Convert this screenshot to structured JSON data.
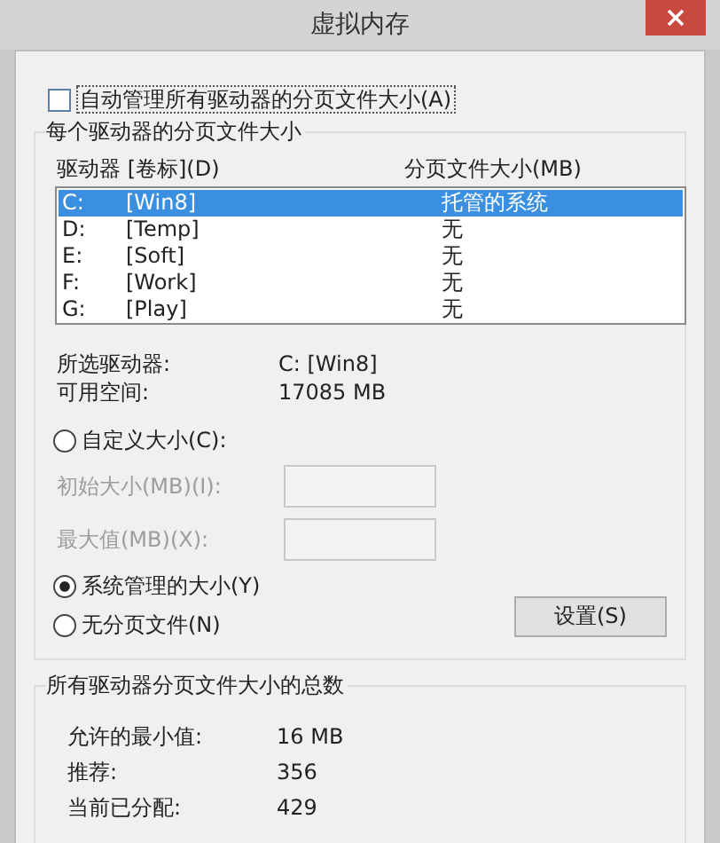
{
  "window": {
    "title": "虚拟内存"
  },
  "auto_manage": {
    "label": "自动管理所有驱动器的分页文件大小(A)",
    "checked": false
  },
  "per_drive": {
    "title": "每个驱动器的分页文件大小",
    "columns": [
      "驱动器 [卷标](D)",
      "分页文件大小(MB)"
    ],
    "drives": [
      {
        "letter": "C:",
        "label": "[Win8]",
        "size": "托管的系统",
        "selected": true
      },
      {
        "letter": "D:",
        "label": "[Temp]",
        "size": "无",
        "selected": false
      },
      {
        "letter": "E:",
        "label": "[Soft]",
        "size": "无",
        "selected": false
      },
      {
        "letter": "F:",
        "label": "[Work]",
        "size": "无",
        "selected": false
      },
      {
        "letter": "G:",
        "label": "[Play]",
        "size": "无",
        "selected": false
      }
    ],
    "info": [
      {
        "label": "所选驱动器:",
        "value": "C:  [Win8]"
      },
      {
        "label": "可用空间:",
        "value": "17085 MB"
      }
    ],
    "options": [
      {
        "label": "自定义大小(C):",
        "selected": false,
        "fields": [
          {
            "label": "初始大小(MB)(I):",
            "disabled": true
          },
          {
            "label": "最大值(MB)(X):",
            "disabled": true
          }
        ]
      },
      {
        "label": "系统管理的大小(Y)",
        "selected": true
      },
      {
        "label": "无分页文件(N)",
        "selected": false
      }
    ],
    "set_button": "设置(S)"
  },
  "totals": {
    "title": "所有驱动器分页文件大小的总数",
    "rows": [
      {
        "label": "允许的最小值:",
        "value": "16 MB"
      },
      {
        "label": "推荐:",
        "value": "356"
      },
      {
        "label": "当前已分配:",
        "value": "429"
      }
    ]
  }
}
